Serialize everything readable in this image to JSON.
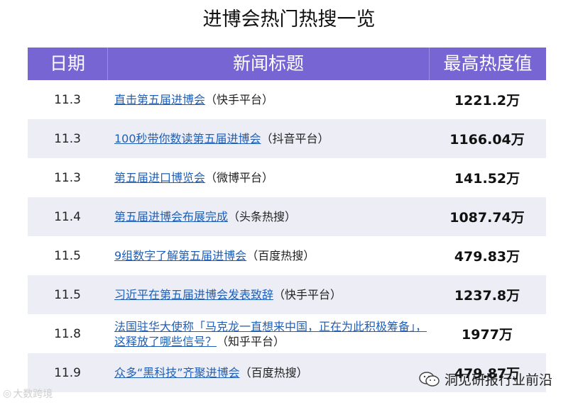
{
  "title": "进博会热门热搜一览",
  "table": {
    "headers": {
      "date": "日期",
      "news": "新闻标题",
      "heat": "最高热度值"
    },
    "rows": [
      {
        "date": "11.3",
        "title": "直击第五届进博会",
        "source": "（快手平台）",
        "heat": "1221.2万"
      },
      {
        "date": "11.3",
        "title": "100秒带你数读第五届进博会",
        "source": "（抖音平台）",
        "heat": "1166.04万"
      },
      {
        "date": "11.3",
        "title": "第五届进口博览会",
        "source": "（微博平台）",
        "heat": "141.52万"
      },
      {
        "date": "11.4",
        "title": "第五届进博会布展完成",
        "source": "（头条热搜）",
        "heat": "1087.74万"
      },
      {
        "date": "11.5",
        "title": "9组数字了解第五届进博会",
        "source": "（百度热搜）",
        "heat": "479.83万"
      },
      {
        "date": "11.5",
        "title": "习近平在第五届进博会发表致辞",
        "source": "（快手平台）",
        "heat": "1237.8万"
      },
      {
        "date": "11.8",
        "title": "法国驻华大使称「马克龙一直想来中国，正在为此积极筹备」，这释放了哪些信号？",
        "source": "（知乎平台）",
        "heat": "1977万"
      },
      {
        "date": "11.9",
        "title": "众多“黑科技”齐聚进博会",
        "source": "（百度热搜）",
        "heat": "479.87万"
      }
    ]
  },
  "watermark_left": "大数跨境",
  "watermark_right": "洞见研报行业前沿",
  "colors": {
    "header_bg": "#7665d3",
    "alt_row": "#edeef5",
    "link": "#1f5fb5"
  }
}
